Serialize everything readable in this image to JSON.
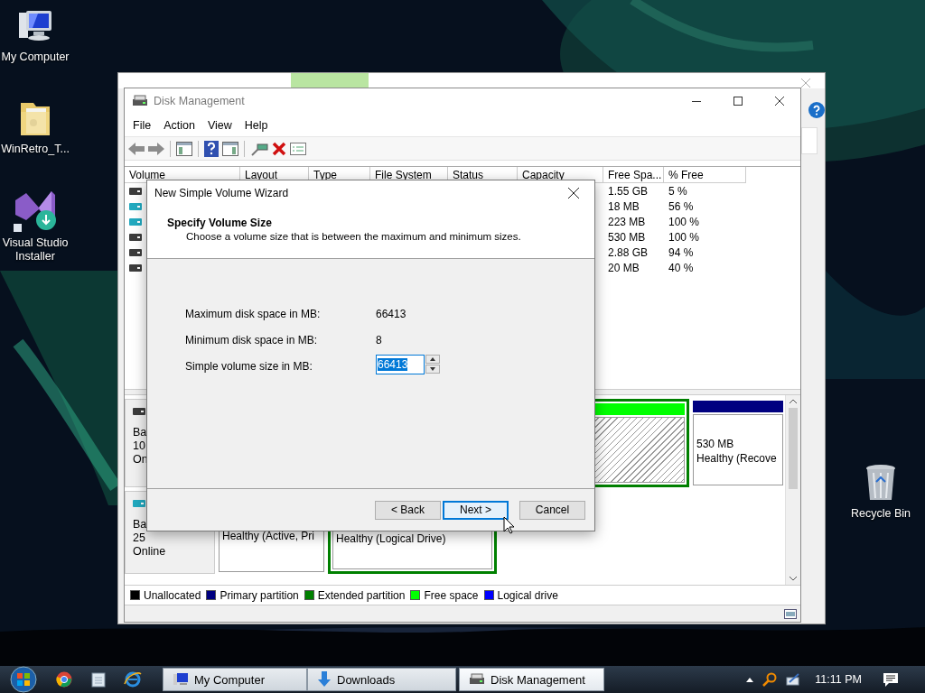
{
  "desktop_icons": [
    {
      "kind": "computer",
      "label": "My Computer"
    },
    {
      "kind": "folder",
      "label": "WinRetro_T..."
    },
    {
      "kind": "installer",
      "label": "Visual Studio Installer"
    },
    {
      "kind": "recycle_bin",
      "label": "Recycle Bin"
    }
  ],
  "disk_management": {
    "title": "Disk Management",
    "menu": [
      "File",
      "Action",
      "View",
      "Help"
    ],
    "columns": [
      "Volume",
      "Layout",
      "Type",
      "File System",
      "Status",
      "Capacity",
      "Free Spa...",
      "% Free"
    ],
    "rows": [
      {
        "color": "#3c3c3c",
        "free_space": "1.55 GB",
        "percent_free": "5 %"
      },
      {
        "color": "#22a9bf",
        "free_space": "18 MB",
        "percent_free": "56 %"
      },
      {
        "color": "#22a9bf",
        "free_space": "223 MB",
        "percent_free": "100 %"
      },
      {
        "color": "#3c3c3c",
        "free_space": "530 MB",
        "percent_free": "100 %"
      },
      {
        "color": "#3c3c3c",
        "free_space": "2.88 GB",
        "percent_free": "94 %"
      },
      {
        "color": "#3c3c3c",
        "free_space": "20 MB",
        "percent_free": "40 %"
      }
    ],
    "disks": [
      {
        "color": "#3c3c3c",
        "label_lines": [
          "Ba",
          "10",
          "On"
        ],
        "partitions": [
          {
            "kind": "free"
          },
          {
            "kind": "primary",
            "lines": [
              "530 MB",
              "Healthy (Recove"
            ]
          }
        ]
      },
      {
        "color": "#22a9bf",
        "label_lines": [
          "Ba",
          "25",
          "Online"
        ],
        "partitions": [
          {
            "kind": "primary",
            "lines": [
              "Healthy (Active, Pri"
            ]
          },
          {
            "kind": "logical",
            "lines": [
              "Healthy (Logical Drive)"
            ]
          }
        ]
      }
    ],
    "legend": [
      {
        "label": "Unallocated",
        "color": "#000000"
      },
      {
        "label": "Primary partition",
        "color": "#000080"
      },
      {
        "label": "Extended partition",
        "color": "#008000"
      },
      {
        "label": "Free space",
        "color": "#00ff00"
      },
      {
        "label": "Logical drive",
        "color": "#0000ff"
      }
    ]
  },
  "dialog": {
    "title": "New Simple Volume Wizard",
    "heading": "Specify Volume Size",
    "subtitle": "Choose a volume size that is between the maximum and minimum sizes.",
    "fields": [
      {
        "kind": "text",
        "label": "Maximum disk space in MB:",
        "value": "66413"
      },
      {
        "kind": "text",
        "label": "Minimum disk space in MB:",
        "value": "8"
      },
      {
        "kind": "spin",
        "label": "Simple volume size in MB:",
        "value": "66413",
        "text_selected": true
      }
    ],
    "buttons": [
      {
        "label": "< Back",
        "focused": false
      },
      {
        "label": "Next >",
        "focused": true
      },
      {
        "label": "Cancel",
        "focused": false
      }
    ]
  },
  "taskbar": {
    "tasks": [
      {
        "kind": "computer",
        "label": "My Computer",
        "selected": false
      },
      {
        "kind": "download",
        "label": "Downloads",
        "selected": false
      },
      {
        "kind": "disk",
        "label": "Disk Management",
        "selected": true
      }
    ],
    "clock": "11:11 PM"
  }
}
